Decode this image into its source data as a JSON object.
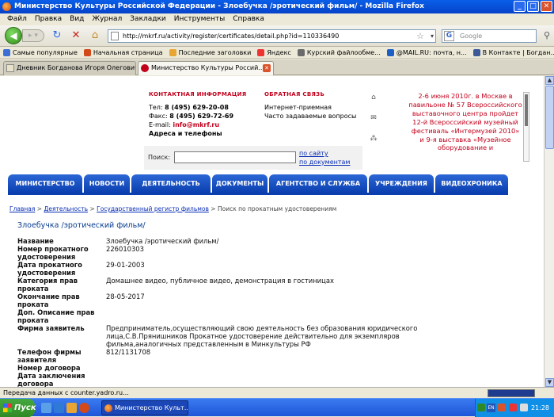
{
  "window": {
    "title": "Министерство Культуры Российской Федерации - Злоебучка /эротический фильм/ - Mozilla Firefox",
    "buttons": [
      "_",
      "□",
      "✕"
    ]
  },
  "menu": [
    "Файл",
    "Правка",
    "Вид",
    "Журнал",
    "Закладки",
    "Инструменты",
    "Справка"
  ],
  "toolbar": {
    "url": "http://mkrf.ru/activity/register/certificates/detail.php?id=110336490",
    "search_placeholder": "Google"
  },
  "bookmarks": [
    {
      "label": "Самые популярные",
      "color": "#3b6fd6"
    },
    {
      "label": "Начальная страница",
      "color": "#d2491a"
    },
    {
      "label": "Последние заголовки",
      "color": "#e8a534"
    },
    {
      "label": "Яндекс",
      "color": "#e33"
    },
    {
      "label": "Курский файлообме...",
      "color": "#6a6a6a"
    },
    {
      "label": "@MAIL.RU: почта, н...",
      "color": "#1d5fc4"
    },
    {
      "label": "В Контакте | Богдан...",
      "color": "#3b5998"
    }
  ],
  "tabs": [
    {
      "label": "Дневник Богданова Игоря Олегович...",
      "active": false
    },
    {
      "label": "Министерство Культуры Россий...",
      "active": true
    }
  ],
  "page": {
    "contact": {
      "heading": "КОНТАКТНАЯ ИНФОРМАЦИЯ",
      "tel_label": "Тел:",
      "tel": "8 (495) 629-20-08",
      "fax_label": "Факс:",
      "fax": "8 (495) 629-72-69",
      "email_label": "E-mail:",
      "email": "info@mkrf.ru",
      "address": "Адреса и телефоны"
    },
    "feedback": {
      "heading": "ОБРАТНАЯ СВЯЗЬ",
      "items": [
        "Интернет-приемная",
        "Часто задаваемые вопросы"
      ]
    },
    "side_icons": [
      "home-icon",
      "mail-icon",
      "sitemap-icon"
    ],
    "announce": "2-6 июня 2010г. в Москве в павильоне № 57 Всероссийского выставочного центра пройдет 12-й Всероссийский музейный фестиваль «Интермузей 2010» и 9-я выставка «Музейное оборудование и",
    "search": {
      "label": "Поиск:",
      "value": "",
      "link_site": "по сайту",
      "link_docs": "по документам"
    },
    "nav": [
      "МИНИСТЕРСТВО",
      "НОВОСТИ",
      "ДЕЯТЕЛЬНОСТЬ",
      "ДОКУМЕНТЫ",
      "АГЕНТСТВО И СЛУЖБА",
      "УЧРЕЖДЕНИЯ",
      "ВИДЕОХРОНИКА"
    ],
    "breadcrumbs": {
      "home": "Главная",
      "sep": " > ",
      "activity": "Деятельность",
      "register": "Государственный регистр фильмов",
      "current": "Поиск по прокатным удостоверениям"
    },
    "title": "Злоебучка /эротический фильм/",
    "details": [
      {
        "key": "Название",
        "value": "Злоебучка /эротический фильм/"
      },
      {
        "key": "Номер прокатного удостоверения",
        "value": "226010303"
      },
      {
        "key": "Дата прокатного удостоверения",
        "value": "29-01-2003"
      },
      {
        "key": "Категория прав проката",
        "value": "Домашнее видео, публичное видео, демонстрация в гостиницах"
      },
      {
        "key": "Окончание прав проката",
        "value": "28-05-2017"
      },
      {
        "key": "Доп. Описание прав проката",
        "value": ""
      },
      {
        "key": "Фирма заявитель",
        "value": "Предприниматель,осуществляющий свою деятельность без образования юридического лица,С.В.Прянишников Прокатное удостоверение действительно для экземпляров фильма,аналогичных представленным в Минкультуры РФ"
      },
      {
        "key": "Телефон фирмы заявителя",
        "value": "812/1131708"
      },
      {
        "key": "Номер договора",
        "value": ""
      },
      {
        "key": "Дата заключения договора",
        "value": ""
      }
    ]
  },
  "status": "Передача данных с counter.yadro.ru...",
  "taskbar": {
    "start": "Пуск",
    "item": "Министерство Культ...",
    "lang": "EN",
    "clock": "21:28"
  }
}
